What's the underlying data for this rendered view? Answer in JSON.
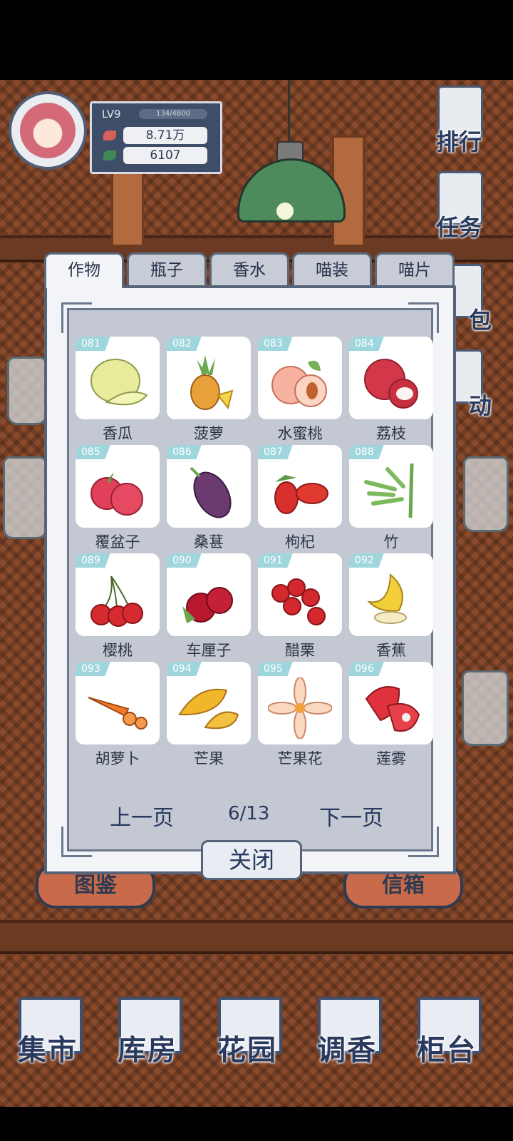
{
  "profile": {
    "level": "LV9",
    "exp": "134/4800",
    "coins": "8.71万",
    "leaves": "6107"
  },
  "side_menu": [
    "排行",
    "任务",
    "包",
    "动"
  ],
  "tabs": [
    "作物",
    "瓶子",
    "香水",
    "喵装",
    "喵片"
  ],
  "active_tab": "作物",
  "items": [
    {
      "num": "081",
      "name": "香瓜"
    },
    {
      "num": "082",
      "name": "菠萝"
    },
    {
      "num": "083",
      "name": "水蜜桃"
    },
    {
      "num": "084",
      "name": "荔枝"
    },
    {
      "num": "085",
      "name": "覆盆子"
    },
    {
      "num": "086",
      "name": "桑葚"
    },
    {
      "num": "087",
      "name": "枸杞"
    },
    {
      "num": "088",
      "name": "竹"
    },
    {
      "num": "089",
      "name": "樱桃"
    },
    {
      "num": "090",
      "name": "车厘子"
    },
    {
      "num": "091",
      "name": "醋栗"
    },
    {
      "num": "092",
      "name": "香蕉"
    },
    {
      "num": "093",
      "name": "胡萝卜"
    },
    {
      "num": "094",
      "name": "芒果"
    },
    {
      "num": "095",
      "name": "芒果花"
    },
    {
      "num": "096",
      "name": "莲雾"
    }
  ],
  "pager": {
    "prev": "上一页",
    "page": "6/13",
    "next": "下一页"
  },
  "close_label": "关闭",
  "signs": [
    "图鉴",
    "信箱"
  ],
  "bottom_nav": [
    "集市",
    "库房",
    "花园",
    "调香",
    "柜台"
  ],
  "colors": {
    "panel_border": "#566379",
    "tile_number": "#9fd6dd",
    "text_dark": "#27395f"
  }
}
